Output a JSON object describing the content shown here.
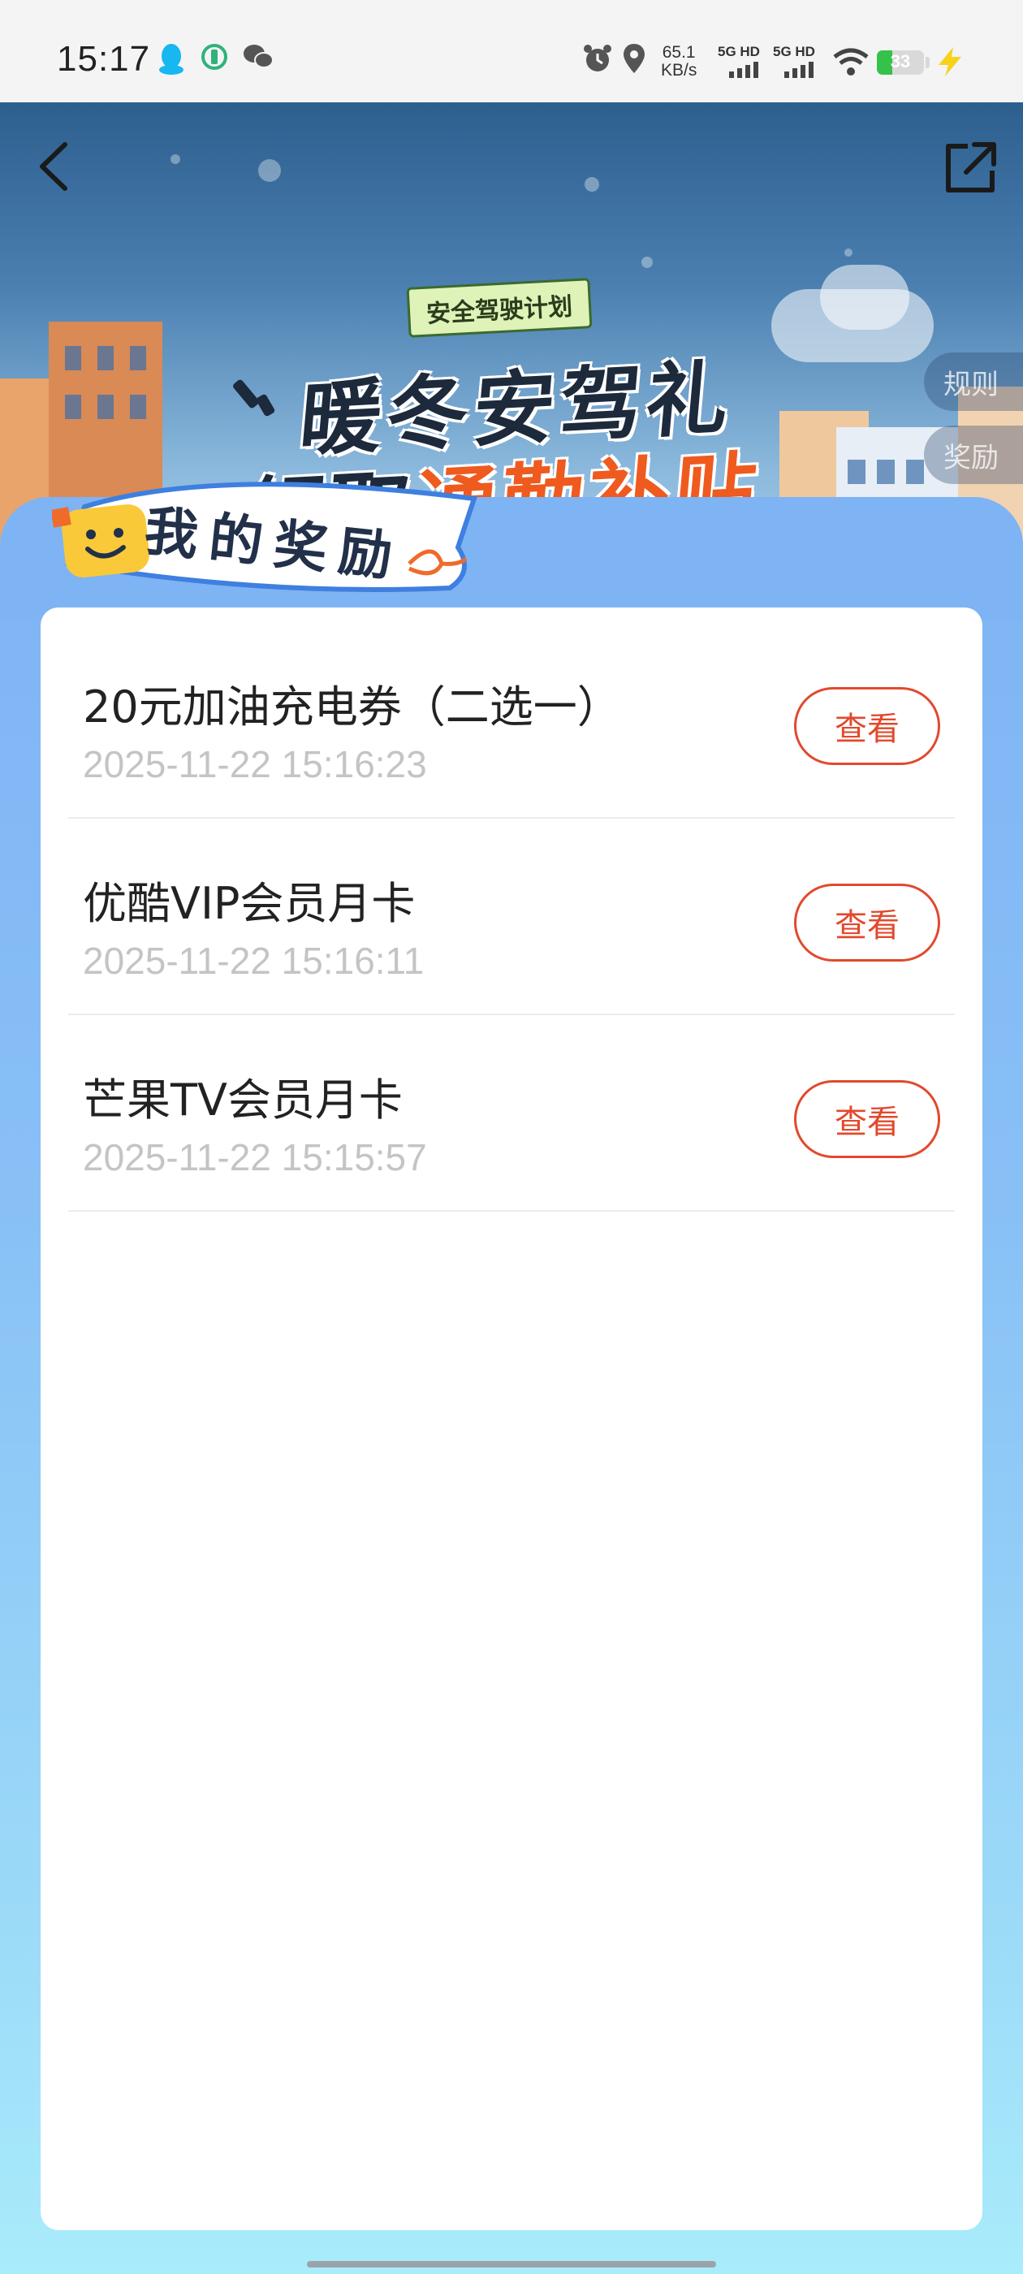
{
  "status_bar": {
    "time": "15:17",
    "net_speed_value": "65.1",
    "net_speed_unit": "KB/s",
    "sim1": "5G HD",
    "sim2": "5G HD",
    "battery": "33",
    "battery_level": 0.33,
    "icons": [
      "qq-icon",
      "app-icon",
      "wechat-icon",
      "alarm-icon",
      "location-icon",
      "wifi-icon",
      "charging-icon"
    ]
  },
  "nav": {
    "back_icon": "chevron-left-icon",
    "share_icon": "share-external-icon"
  },
  "banner": {
    "tag": "安全驾驶计划",
    "title_line1": "暖冬安驾礼",
    "title_line2_a": "领取",
    "title_line2_b": "通勤",
    "title_line2_c": "补贴",
    "rules_button": "规则",
    "rewards_button": "奖励"
  },
  "section": {
    "title": "我的奖励"
  },
  "rewards": [
    {
      "name": "20元加油充电券（二选一）",
      "date": "2025-11-22 15:16:23",
      "action": "查看"
    },
    {
      "name": "优酷VIP会员月卡",
      "date": "2025-11-22 15:16:11",
      "action": "查看"
    },
    {
      "name": "芒果TV会员月卡",
      "date": "2025-11-22 15:15:57",
      "action": "查看"
    }
  ],
  "colors": {
    "accent": "#e1492d",
    "panel_top": "#7eb3f4",
    "panel_bottom": "#a9ecfb",
    "date_text": "#c4c4c4"
  }
}
